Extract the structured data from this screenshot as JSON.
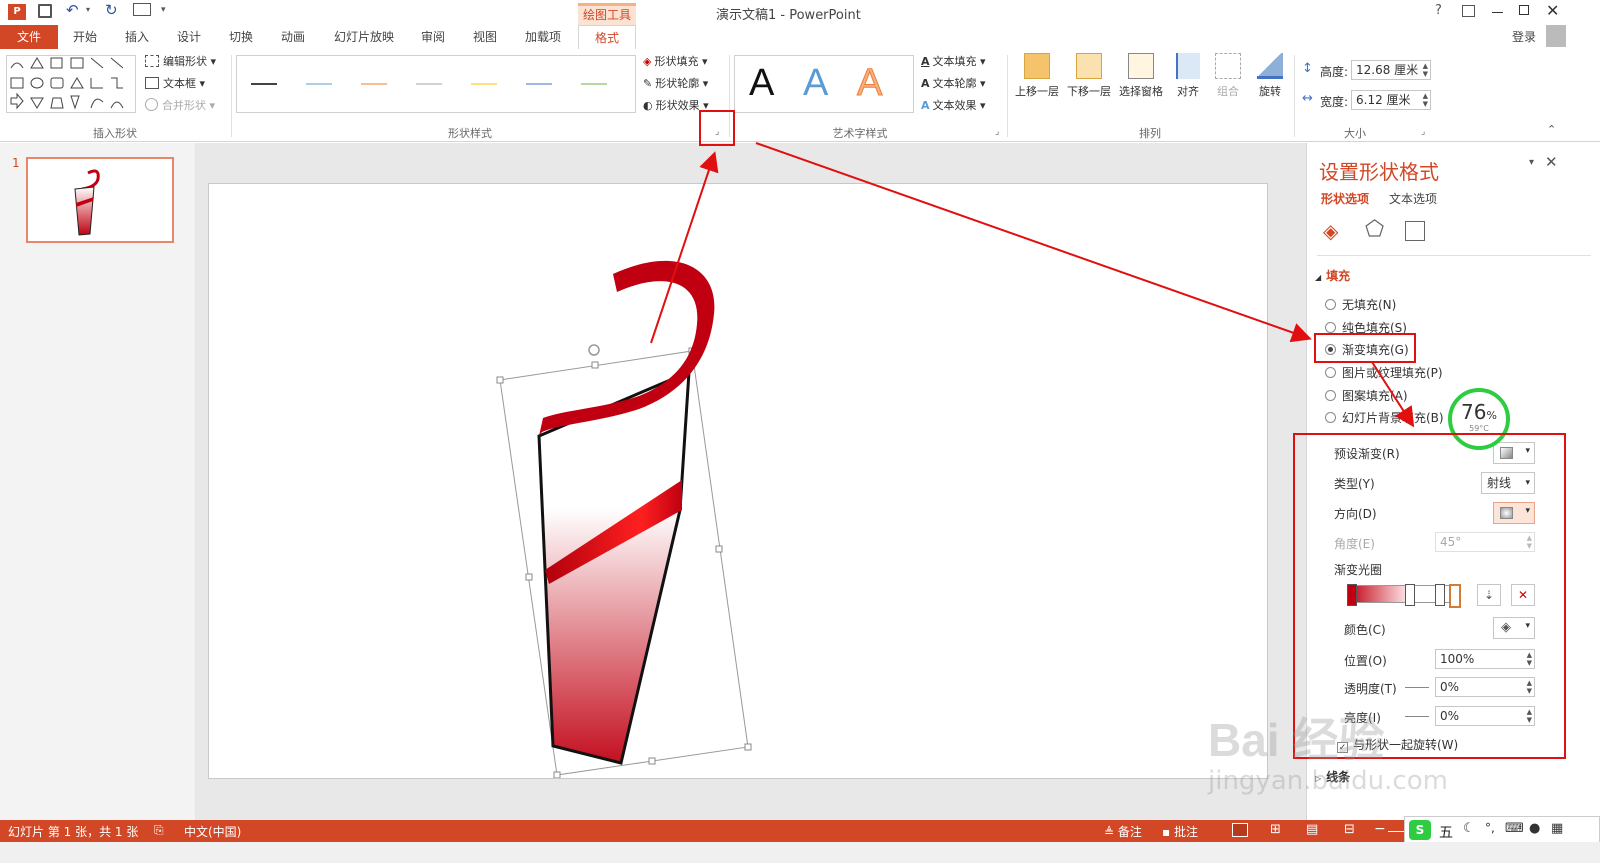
{
  "window": {
    "title": "演示文稿1 - PowerPoint",
    "context_tab_group": "绘图工具",
    "help": "?",
    "login": "登录"
  },
  "tabs": [
    "文件",
    "开始",
    "插入",
    "设计",
    "切换",
    "动画",
    "幻灯片放映",
    "审阅",
    "视图",
    "加载项",
    "格式"
  ],
  "ribbon": {
    "insert_shapes": {
      "edit_shape": "编辑形状",
      "text_box": "文本框",
      "merge_shapes": "合并形状",
      "label": "插入形状"
    },
    "shape_styles": {
      "fill": "形状填充",
      "outline": "形状轮廓",
      "effects": "形状效果",
      "label": "形状样式",
      "line_colors": [
        "#444444",
        "#5b9bd5",
        "#ed7d31",
        "#a5a5a5",
        "#ffc000",
        "#4472c4",
        "#70ad47"
      ]
    },
    "wordart": {
      "sample": "A",
      "text_fill": "文本填充",
      "text_outline": "文本轮廓",
      "text_effects": "文本效果",
      "label": "艺术字样式"
    },
    "arrange": {
      "bring_forward": "上移一层",
      "send_backward": "下移一层",
      "selection_pane": "选择窗格",
      "align": "对齐",
      "group": "组合",
      "rotate": "旋转",
      "label": "排列"
    },
    "size": {
      "height_label": "高度:",
      "height_value": "12.68 厘米",
      "width_label": "宽度:",
      "width_value": "6.12 厘米",
      "label": "大小"
    }
  },
  "thumbnails": {
    "number": "1"
  },
  "pane": {
    "title": "设置形状格式",
    "tab_shape": "形状选项",
    "tab_text": "文本选项",
    "fill_section": "填充",
    "fill_options": [
      "无填充(N)",
      "纯色填充(S)",
      "渐变填充(G)",
      "图片或纹理填充(P)",
      "图案填充(A)",
      "幻灯片背景填充(B)"
    ],
    "selected_fill_index": 2,
    "preset_gradient": "预设渐变(R)",
    "type_label": "类型(Y)",
    "type_value": "射线",
    "direction_label": "方向(D)",
    "angle_label": "角度(E)",
    "angle_value": "45°",
    "stops_label": "渐变光圈",
    "color_label": "颜色(C)",
    "position_label": "位置(O)",
    "position_value": "100%",
    "transparency_label": "透明度(T)",
    "transparency_value": "0%",
    "brightness_label": "亮度(I)",
    "brightness_value": "0%",
    "rotate_with_shape": "与形状一起旋转(W)",
    "line_section": "线条"
  },
  "overlay": {
    "percent": "76",
    "percent_sign": "%",
    "temp": "59°C"
  },
  "status": {
    "slide_info": "幻灯片 第 1 张，共 1 张",
    "language": "中文(中国)",
    "notes": "备注",
    "comments": "批注",
    "ime": "五"
  },
  "watermark": {
    "brand": "Bai 经验",
    "url": "jingyan.baidu.com"
  },
  "colors": {
    "accent": "#d24726",
    "annotation": "#e01010",
    "shape_red": "#c00010"
  }
}
